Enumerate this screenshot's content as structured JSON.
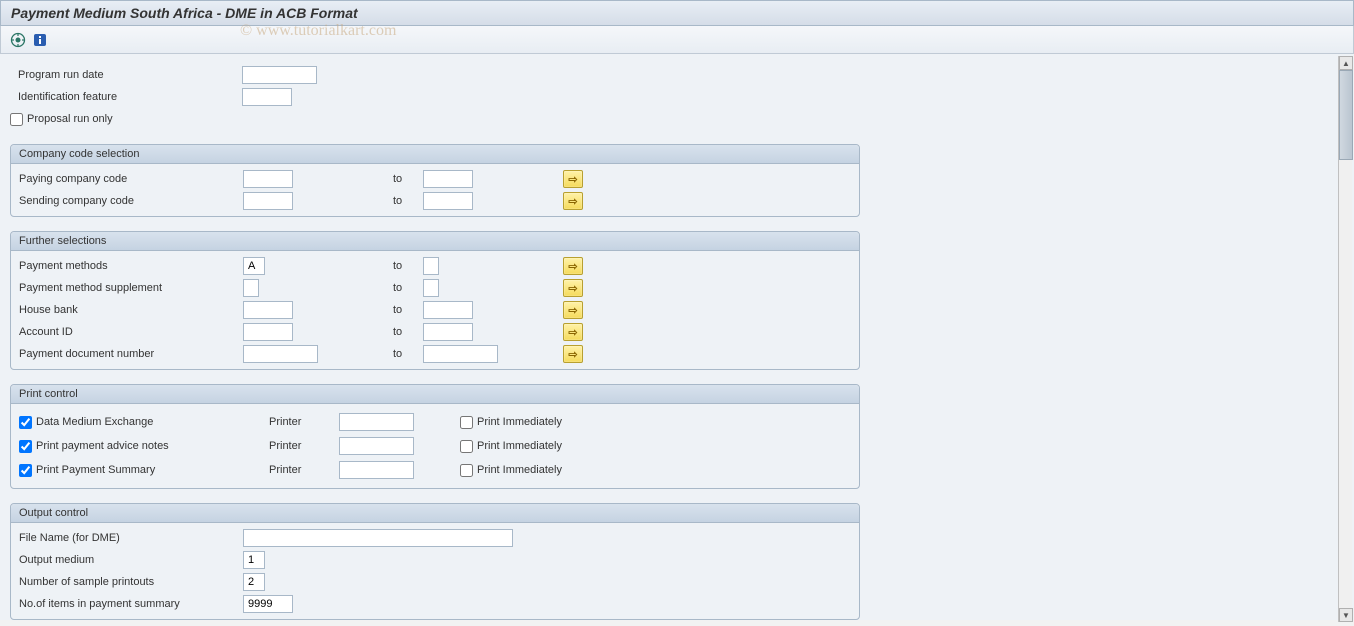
{
  "title": "Payment Medium South Africa - DME in ACB Format",
  "watermark": "© www.tutorialkart.com",
  "top": {
    "program_run_date_label": "Program run date",
    "program_run_date_value": "",
    "identification_label": "Identification feature",
    "identification_value": "",
    "proposal_label": "Proposal run only",
    "proposal_checked": false
  },
  "groups": {
    "company": {
      "title": "Company code selection",
      "rows": [
        {
          "label": "Paying company code",
          "from": "",
          "to_label": "to",
          "to": ""
        },
        {
          "label": "Sending company code",
          "from": "",
          "to_label": "to",
          "to": ""
        }
      ]
    },
    "further": {
      "title": "Further selections",
      "rows": [
        {
          "label": "Payment methods",
          "from": "A",
          "to_label": "to",
          "to": "",
          "short": true
        },
        {
          "label": "Payment method supplement",
          "from": "",
          "to_label": "to",
          "to": "",
          "short": true
        },
        {
          "label": "House bank",
          "from": "",
          "to_label": "to",
          "to": ""
        },
        {
          "label": "Account ID",
          "from": "",
          "to_label": "to",
          "to": ""
        },
        {
          "label": "Payment document number",
          "from": "",
          "to_label": "to",
          "to": ""
        }
      ]
    },
    "print": {
      "title": "Print control",
      "printer_label": "Printer",
      "print_imm_label": "Print Immediately",
      "rows": [
        {
          "label": "Data Medium Exchange",
          "checked": true,
          "printer": "",
          "immediate": false
        },
        {
          "label": "Print payment advice notes",
          "checked": true,
          "printer": "",
          "immediate": false
        },
        {
          "label": "Print Payment Summary",
          "checked": true,
          "printer": "",
          "immediate": false
        }
      ]
    },
    "output": {
      "title": "Output control",
      "rows": [
        {
          "label": "File Name (for DME)",
          "value": "",
          "wide": true
        },
        {
          "label": "Output medium",
          "value": "1"
        },
        {
          "label": "Number of sample printouts",
          "value": "2"
        },
        {
          "label": "No.of items in payment summary",
          "value": "9999"
        }
      ]
    }
  },
  "icons": {
    "execute": "execute-icon",
    "info": "info-icon",
    "arrow_right": "⇨"
  }
}
